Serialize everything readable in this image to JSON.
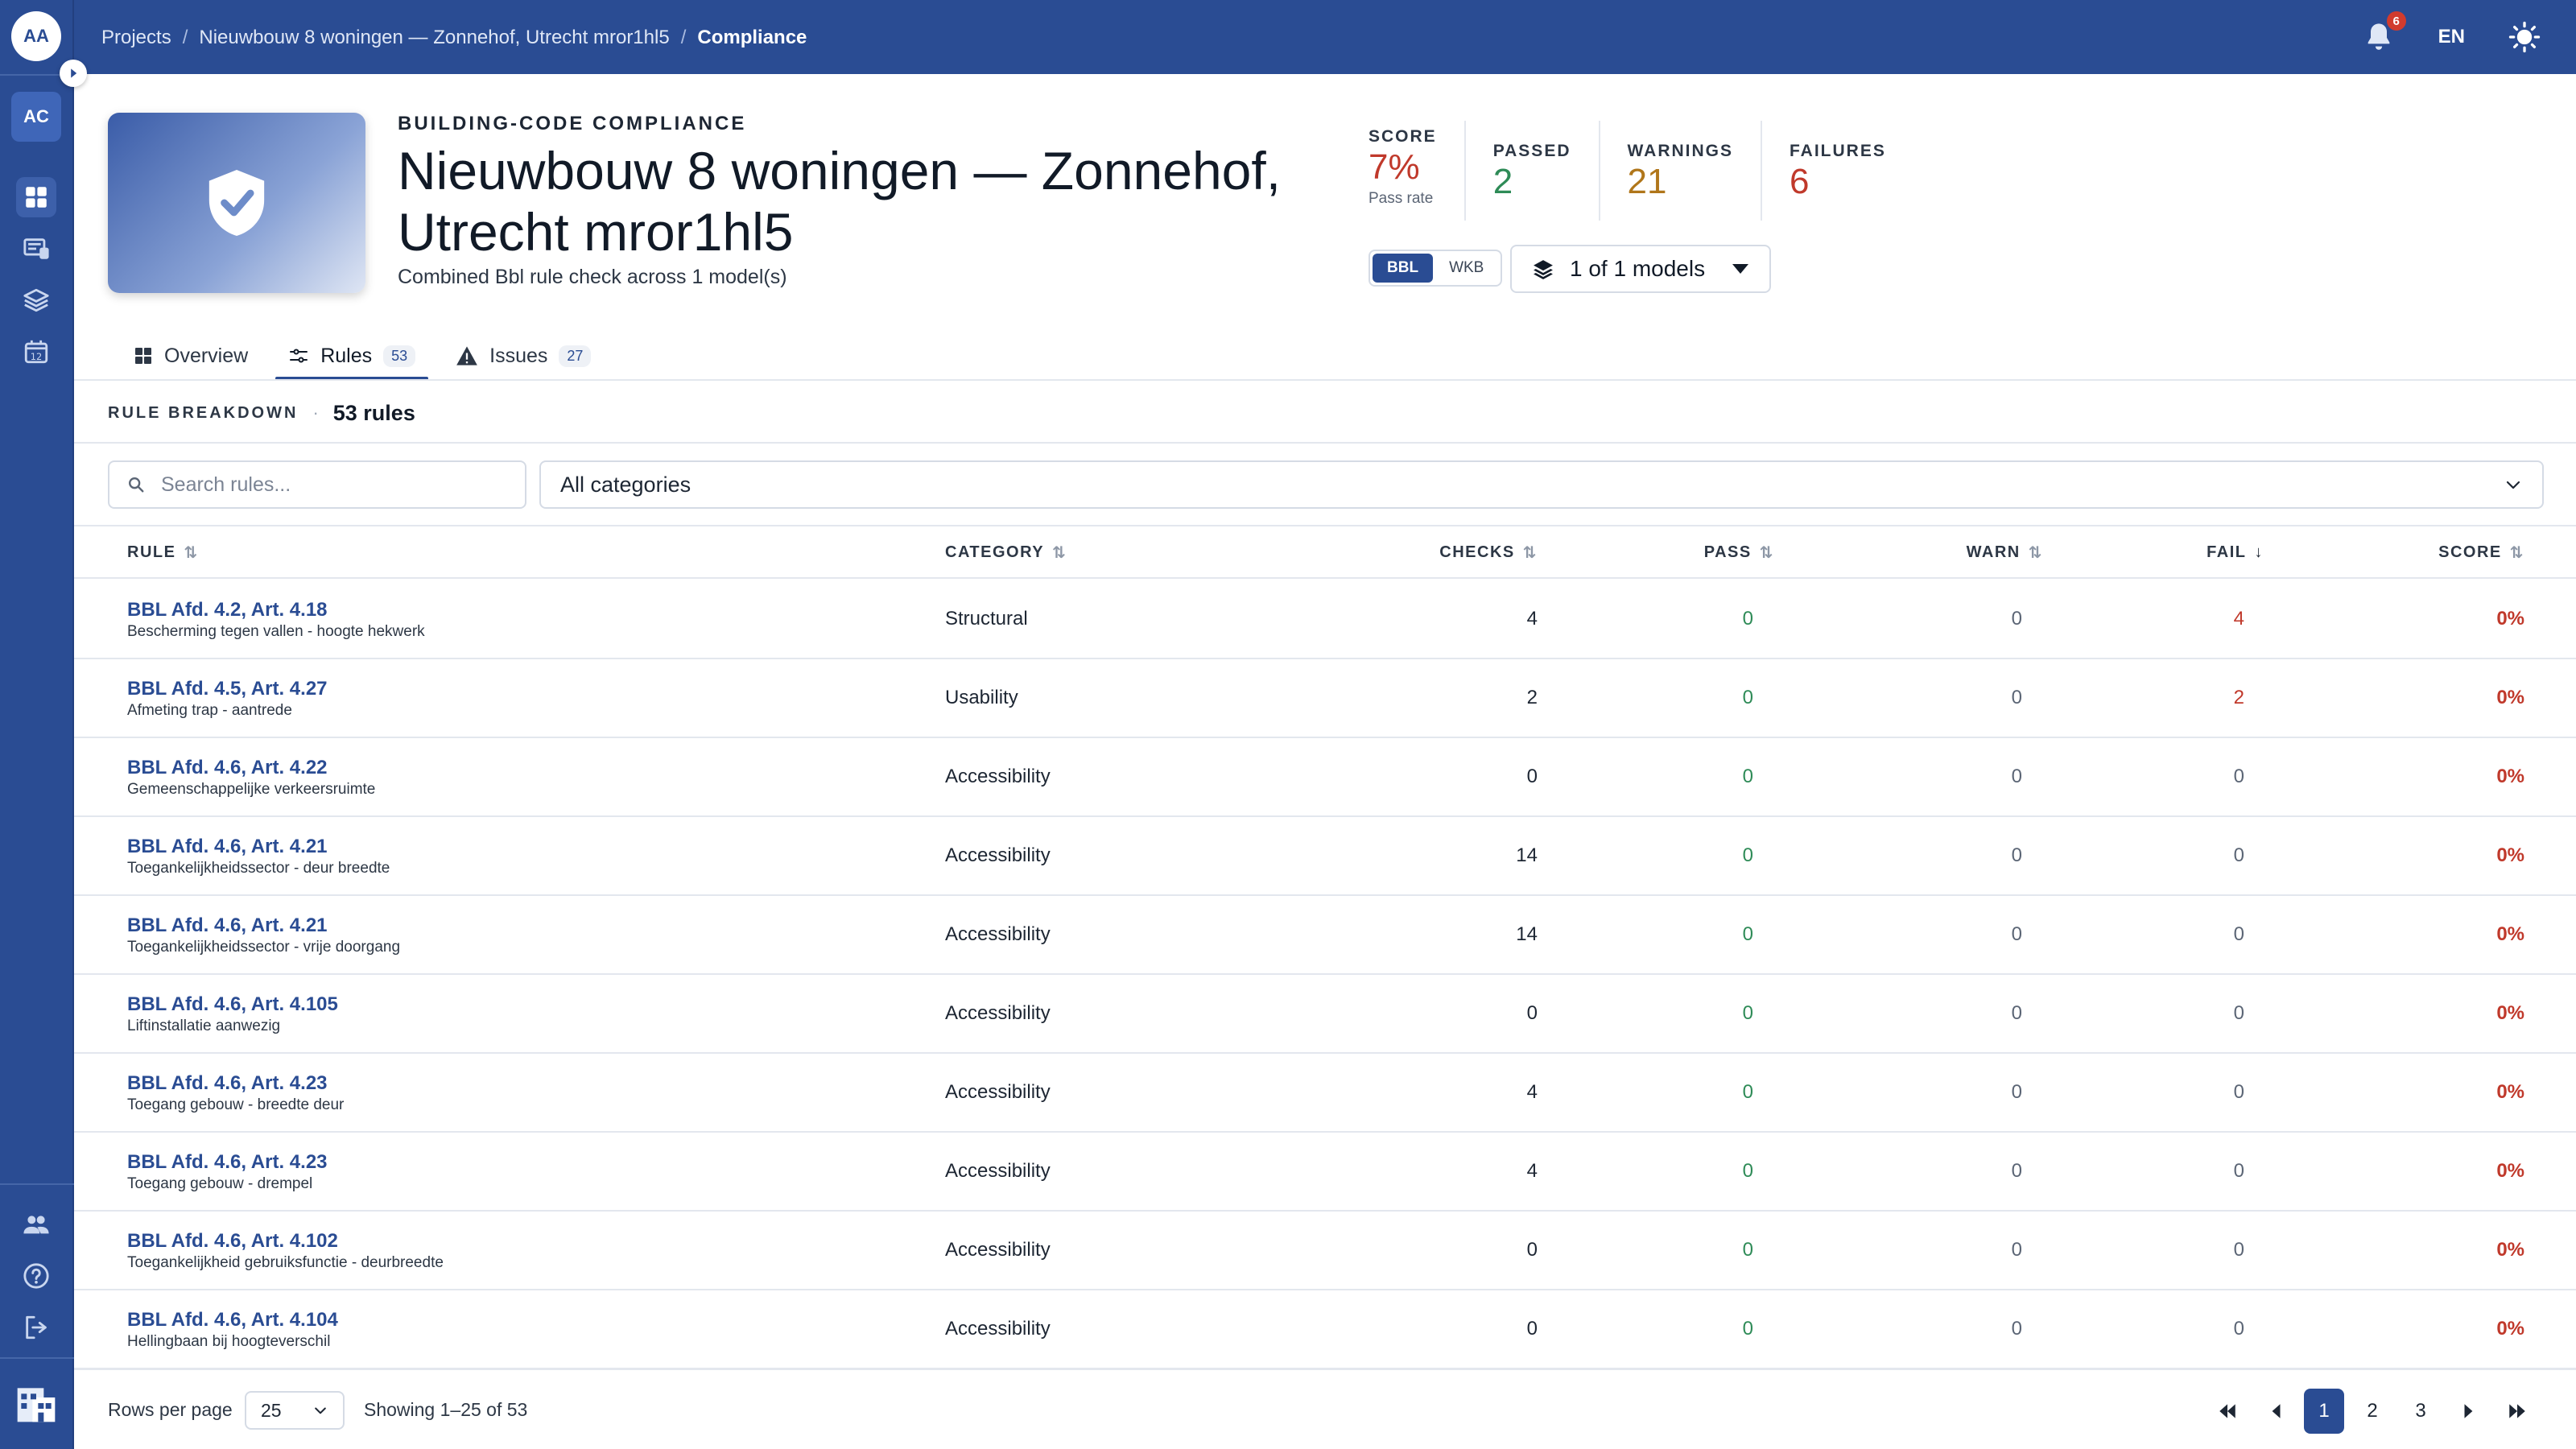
{
  "header": {
    "avatar_initials": "AA",
    "breadcrumb": [
      "Projects",
      "Nieuwbouw 8 woningen — Zonnehof, Utrecht mror1hl5",
      "Compliance"
    ],
    "notifications_count": "6",
    "language": "EN"
  },
  "sidebar": {
    "org_initials": "AC",
    "icons": [
      "dashboard-icon",
      "projects-icon",
      "layers-icon",
      "calendar-icon",
      "team-icon",
      "help-icon",
      "logout-icon"
    ],
    "calendar_day": "12"
  },
  "hero": {
    "eyebrow": "BUILDING-CODE COMPLIANCE",
    "title": "Nieuwbouw 8 woningen — Zonnehof, Utrecht mror1hl5",
    "subtitle": "Combined Bbl rule check across 1 model(s)"
  },
  "stats": {
    "score_label": "SCORE",
    "score_value": "7%",
    "score_sub": "Pass rate",
    "passed_label": "PASSED",
    "passed_value": "2",
    "warnings_label": "WARNINGS",
    "warnings_value": "21",
    "failures_label": "FAILURES",
    "failures_value": "6"
  },
  "standards": {
    "options": [
      "BBL",
      "WKB"
    ],
    "selected": "BBL"
  },
  "models_button": "1 of 1 models",
  "tabs": [
    {
      "label": "Overview",
      "count": ""
    },
    {
      "label": "Rules",
      "count": "53"
    },
    {
      "label": "Issues",
      "count": "27"
    }
  ],
  "section": {
    "eyebrow": "RULE BREAKDOWN",
    "separator": "·",
    "count": "53 rules"
  },
  "filters": {
    "search_placeholder": "Search rules...",
    "category_value": "All categories"
  },
  "table": {
    "headers": {
      "rule": "RULE",
      "category": "CATEGORY",
      "checks": "CHECKS",
      "pass": "PASS",
      "warn": "WARN",
      "fail": "FAIL",
      "score": "SCORE"
    },
    "sort": {
      "column": "fail",
      "direction": "desc"
    },
    "rows": [
      {
        "code": "BBL Afd. 4.2, Art. 4.18",
        "desc": "Bescherming tegen vallen - hoogte hekwerk",
        "category": "Structural",
        "checks": "4",
        "pass": "0",
        "warn": "0",
        "fail": "4",
        "score": "0%"
      },
      {
        "code": "BBL Afd. 4.5, Art. 4.27",
        "desc": "Afmeting trap - aantrede",
        "category": "Usability",
        "checks": "2",
        "pass": "0",
        "warn": "0",
        "fail": "2",
        "score": "0%"
      },
      {
        "code": "BBL Afd. 4.6, Art. 4.22",
        "desc": "Gemeenschappelijke verkeersruimte",
        "category": "Accessibility",
        "checks": "0",
        "pass": "0",
        "warn": "0",
        "fail": "0",
        "score": "0%"
      },
      {
        "code": "BBL Afd. 4.6, Art. 4.21",
        "desc": "Toegankelijkheidssector - deur breedte",
        "category": "Accessibility",
        "checks": "14",
        "pass": "0",
        "warn": "0",
        "fail": "0",
        "score": "0%"
      },
      {
        "code": "BBL Afd. 4.6, Art. 4.21",
        "desc": "Toegankelijkheidssector - vrije doorgang",
        "category": "Accessibility",
        "checks": "14",
        "pass": "0",
        "warn": "0",
        "fail": "0",
        "score": "0%"
      },
      {
        "code": "BBL Afd. 4.6, Art. 4.105",
        "desc": "Liftinstallatie aanwezig",
        "category": "Accessibility",
        "checks": "0",
        "pass": "0",
        "warn": "0",
        "fail": "0",
        "score": "0%"
      },
      {
        "code": "BBL Afd. 4.6, Art. 4.23",
        "desc": "Toegang gebouw - breedte deur",
        "category": "Accessibility",
        "checks": "4",
        "pass": "0",
        "warn": "0",
        "fail": "0",
        "score": "0%"
      },
      {
        "code": "BBL Afd. 4.6, Art. 4.23",
        "desc": "Toegang gebouw - drempel",
        "category": "Accessibility",
        "checks": "4",
        "pass": "0",
        "warn": "0",
        "fail": "0",
        "score": "0%"
      },
      {
        "code": "BBL Afd. 4.6, Art. 4.102",
        "desc": "Toegankelijkheid gebruiksfunctie - deurbreedte",
        "category": "Accessibility",
        "checks": "0",
        "pass": "0",
        "warn": "0",
        "fail": "0",
        "score": "0%"
      },
      {
        "code": "BBL Afd. 4.6, Art. 4.104",
        "desc": "Hellingbaan bij hoogteverschil",
        "category": "Accessibility",
        "checks": "0",
        "pass": "0",
        "warn": "0",
        "fail": "0",
        "score": "0%"
      }
    ]
  },
  "footer": {
    "rows_per_page_label": "Rows per page",
    "rows_per_page_value": "25",
    "showing": "Showing 1–25 of 53",
    "pages": [
      "1",
      "2",
      "3"
    ],
    "current_page": "1"
  },
  "colors": {
    "brand": "#2a4c93",
    "fail": "#c0392b",
    "pass": "#2e8b57",
    "warn": "#b0761a"
  }
}
